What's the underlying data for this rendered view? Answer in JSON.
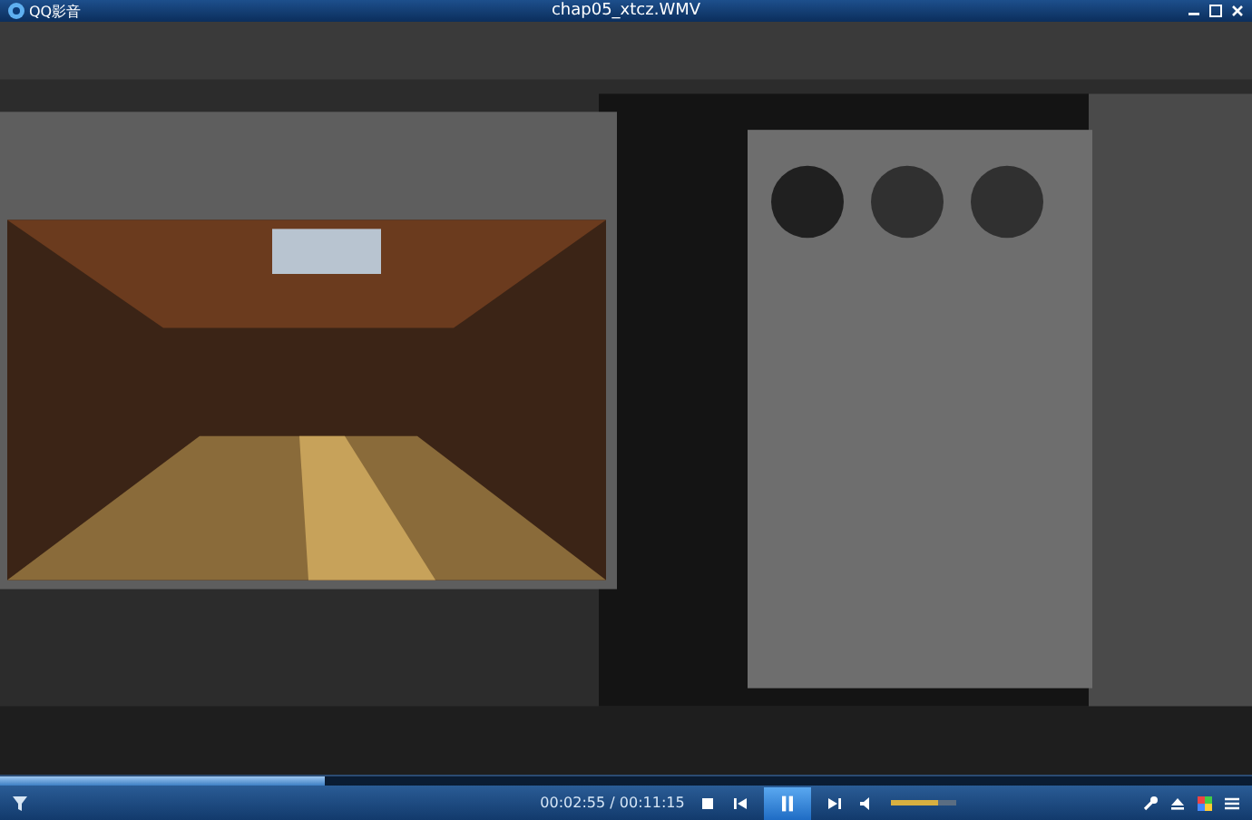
{
  "window": {
    "app_name": "QQ影音",
    "title": "chap05_xtcz.WMV"
  },
  "player": {
    "progress": {
      "level": 0.26
    },
    "time": "00:02:55 / 00:11:15",
    "playing": true,
    "volume": {
      "level": 0.7
    }
  }
}
